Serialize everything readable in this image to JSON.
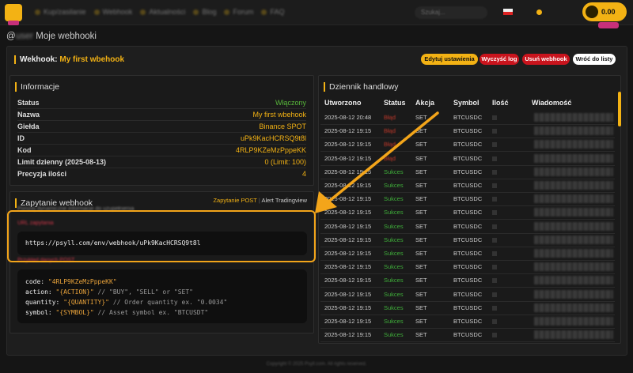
{
  "header": {
    "nav_items": [
      "Kup/zasilanie",
      "Webhook",
      "Aktualności",
      "Blog",
      "Forum",
      "FAQ"
    ],
    "search_placeholder": "Szukaj...",
    "balance": "0.00",
    "accent": "#f3b214"
  },
  "breadcrumb": {
    "user": "user",
    "title": "Moje webhooki"
  },
  "page": {
    "title_prefix": "Wekhook:",
    "title_name": "My first wbehook"
  },
  "actions": {
    "edit": "Edytuj ustawienia",
    "clear": "Wyczyść log",
    "delete": "Usuń webhook",
    "back": "Wróć do listy"
  },
  "info": {
    "title": "Informacje",
    "rows": [
      {
        "label": "Status",
        "value": "Włączony"
      },
      {
        "label": "Nazwa",
        "value": "My first wbehook"
      },
      {
        "label": "Giełda",
        "value": "Binance SPOT"
      },
      {
        "label": "ID",
        "value": "uPk9KacHCRSQ9t8l"
      },
      {
        "label": "Kod",
        "value": "4RLP9KZeMzPppeKK"
      },
      {
        "label": "Limit dzienny (2025-08-13)",
        "value": "0 (Limit: 100)"
      },
      {
        "label": "Precyzja ilości",
        "value": "4"
      }
    ]
  },
  "webhook": {
    "title": "Zapytanie webhook",
    "link_post": "Zapytanie POST",
    "separator": "|",
    "link_tv": "Alert Tradingview",
    "hint": "Poniżej dynamiczne informacje do uzupełnienia",
    "url_label": "URL zapytania",
    "url": "https://psyll.com/env/webhook/uPk9KacHCRSQ9t8l",
    "body_label": "Przykład danych POST",
    "code": {
      "l1k": "code:",
      "l1v": "\"4RLP9KZeMzPppeKK\"",
      "l2k": "action:",
      "l2v": "\"{ACTION}\"",
      "l2c": "// \"BUY\", \"SELL\" or \"SET\"",
      "l3k": "quantity:",
      "l3v": "\"{QUANTITY}\"",
      "l3c": "// Order quantity ex. \"0.0034\"",
      "l4k": "symbol:",
      "l4v": "\"{SYMBOL}\"",
      "l4c": "// Asset symbol ex. \"BTCUSDT\""
    }
  },
  "log": {
    "title": "Dziennik handlowy",
    "columns": [
      "Utworzono",
      "Status",
      "Akcja",
      "Symbol",
      "Ilość",
      "Wiadomość"
    ],
    "rows": [
      {
        "time": "2025-08-12 20:48",
        "status": "Błąd",
        "action": "SET",
        "symbol": "BTCUSDC"
      },
      {
        "time": "2025-08-12 19:15",
        "status": "Błąd",
        "action": "SET",
        "symbol": "BTCUSDC"
      },
      {
        "time": "2025-08-12 19:15",
        "status": "Błąd",
        "action": "SET",
        "symbol": "BTCUSDC"
      },
      {
        "time": "2025-08-12 19:15",
        "status": "Błąd",
        "action": "SET",
        "symbol": "BTCUSDC"
      },
      {
        "time": "2025-08-12 19:15",
        "status": "Sukces",
        "action": "SET",
        "symbol": "BTCUSDC"
      },
      {
        "time": "2025-08-12 19:15",
        "status": "Sukces",
        "action": "SET",
        "symbol": "BTCUSDC"
      },
      {
        "time": "2025-08-12 19:15",
        "status": "Sukces",
        "action": "SET",
        "symbol": "BTCUSDC"
      },
      {
        "time": "2025-08-12 19:15",
        "status": "Sukces",
        "action": "SET",
        "symbol": "BTCUSDC"
      },
      {
        "time": "2025-08-12 19:15",
        "status": "Sukces",
        "action": "SET",
        "symbol": "BTCUSDC"
      },
      {
        "time": "2025-08-12 19:15",
        "status": "Sukces",
        "action": "SET",
        "symbol": "BTCUSDC"
      },
      {
        "time": "2025-08-12 19:15",
        "status": "Sukces",
        "action": "SET",
        "symbol": "BTCUSDC"
      },
      {
        "time": "2025-08-12 19:15",
        "status": "Sukces",
        "action": "SET",
        "symbol": "BTCUSDC"
      },
      {
        "time": "2025-08-12 19:15",
        "status": "Sukces",
        "action": "SET",
        "symbol": "BTCUSDC"
      },
      {
        "time": "2025-08-12 19:15",
        "status": "Sukces",
        "action": "SET",
        "symbol": "BTCUSDC"
      },
      {
        "time": "2025-08-12 19:15",
        "status": "Sukces",
        "action": "SET",
        "symbol": "BTCUSDC"
      },
      {
        "time": "2025-08-12 19:15",
        "status": "Sukces",
        "action": "SET",
        "symbol": "BTCUSDC"
      },
      {
        "time": "2025-08-12 19:15",
        "status": "Sukces",
        "action": "SET",
        "symbol": "BTCUSDC"
      }
    ]
  },
  "footer": "Copyright © 2025 Psyll.com. All rights reserved."
}
